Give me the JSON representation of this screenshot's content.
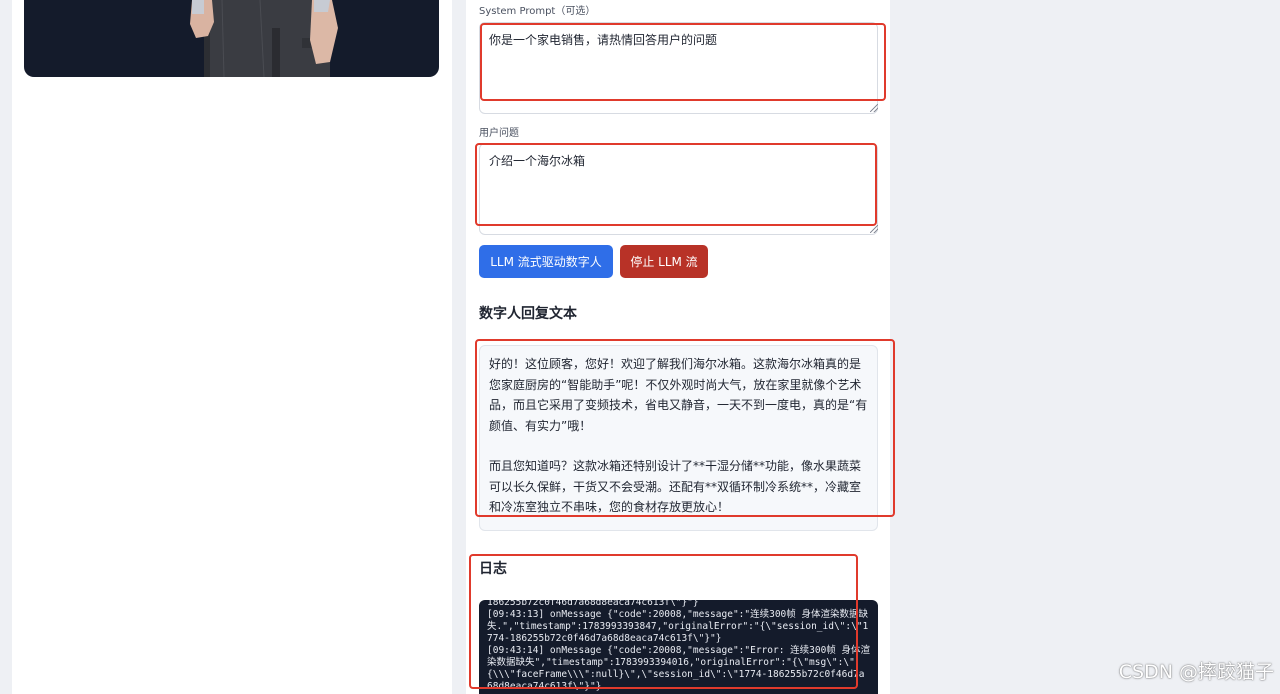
{
  "system_prompt": {
    "label": "System Prompt（可选）",
    "value": "你是一个家电销售，请热情回答用户的问题"
  },
  "user_question": {
    "label": "用户问题",
    "value": "介绍一个海尔冰箱"
  },
  "buttons": {
    "start_label": "LLM 流式驱动数字人",
    "stop_label": "停止 LLM 流"
  },
  "reply": {
    "title": "数字人回复文本",
    "paragraphs": [
      "好的！这位顾客，您好！欢迎了解我们海尔冰箱。这款海尔冰箱真的是您家庭厨房的“智能助手”呢！不仅外观时尚大气，放在家里就像个艺术品，而且它采用了变频技术，省电又静音，一天不到一度电，真的是“有颜值、有实力”哦！",
      "而且您知道吗？这款冰箱还特别设计了**干湿分储**功能，像水果蔬菜可以长久保鲜，干货又不会受潮。还配有**双循环制冷系统**，冷藏室和冷冻室独立不串味，您的食材存放更放心！"
    ]
  },
  "log": {
    "title": "日志",
    "text": "186255b72c0f46d7a68d8eaca74c613f\\\"}\"}\n[09:43:13] onMessage {\"code\":20008,\"message\":\"连续300帧 身体渲染数据缺失.\",\"timestamp\":1783993393847,\"originalError\":\"{\\\"session_id\\\":\\\"1774-186255b72c0f46d7a68d8eaca74c613f\\\"}\"}\n[09:43:14] onMessage {\"code\":20008,\"message\":\"Error: 连续300帧 身体渲染数据缺失\",\"timestamp\":1783993394016,\"originalError\":\"{\\\"msg\\\":\\\"{\\\\\\\"faceFrame\\\\\\\":null}\\\",\\\"session_id\\\":\\\"1774-186255b72c0f46d7a68d8eaca74c613f\\\"}\"}"
  },
  "watermark": "CSDN @摔跤猫子",
  "colors": {
    "start_button": "#2f6ee8",
    "stop_button": "#b83227",
    "annotation": "#e03a2c",
    "log_background": "#141b2b"
  }
}
